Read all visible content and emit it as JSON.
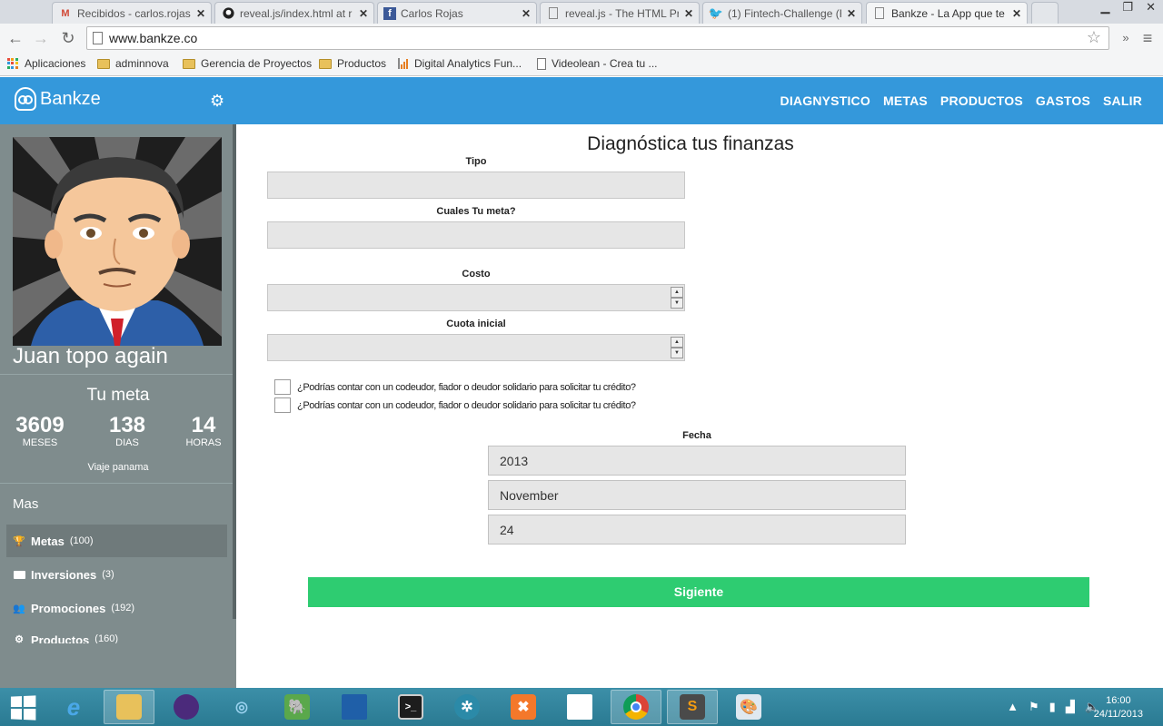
{
  "browser": {
    "tabs": [
      {
        "label": "Recibidos - carlos.rojas@",
        "icon": "gmail-icon"
      },
      {
        "label": "reveal.js/index.html at r",
        "icon": "github-icon"
      },
      {
        "label": "Carlos Rojas",
        "icon": "facebook-icon"
      },
      {
        "label": "reveal.js - The HTML Pr",
        "icon": "page-icon"
      },
      {
        "label": "(1) Fintech-Challenge (F",
        "icon": "twitter-icon"
      },
      {
        "label": "Bankze - La App que te",
        "icon": "page-icon"
      }
    ],
    "url": "www.bankze.co",
    "bookmarks": [
      "Aplicaciones",
      "adminnova",
      "Gerencia de Proyectos",
      "Productos",
      "Digital Analytics Fun...",
      "Videolean - Crea tu ..."
    ]
  },
  "app": {
    "brand": "Bankze",
    "nav": [
      "DIAGNYSTICO",
      "METAS",
      "PRODUCTOS",
      "GASTOS",
      "SALIR"
    ],
    "accent": "#3498db"
  },
  "sidebar": {
    "username": "Juan topo again",
    "goal_title": "Tu meta",
    "stats": [
      {
        "value": "3609",
        "label": "MESES"
      },
      {
        "value": "138",
        "label": "DIAS"
      },
      {
        "value": "14",
        "label": "HORAS"
      }
    ],
    "goal_name": "Viaje panama",
    "section": "Mas",
    "items": [
      {
        "label": "Metas",
        "count": "(100)",
        "icon": "trophy-icon"
      },
      {
        "label": "Inversiones",
        "count": "(3)",
        "icon": "briefcase-icon"
      },
      {
        "label": "Promociones",
        "count": "(192)",
        "icon": "users-icon"
      },
      {
        "label": "Productos",
        "count": "(160)",
        "icon": "gear-icon"
      }
    ]
  },
  "form": {
    "title": "Diagnóstica tus finanzas",
    "tipo_label": "Tipo",
    "meta_label": "Cuales Tu meta?",
    "costo_label": "Costo",
    "cuota_label": "Cuota inicial",
    "check1": "¿Podrías contar con un codeudor, fiador o deudor solidario para solicitar tu crédito?",
    "check2": "¿Podrías contar con un codeudor, fiador o deudor solidario para solicitar tu crédito?",
    "fecha_label": "Fecha",
    "year": "2013",
    "month": "November",
    "day": "24",
    "submit": "Sigiente",
    "button_color": "#2ecc71"
  },
  "taskbar": {
    "time": "16:00",
    "date": "24/11/2013"
  }
}
